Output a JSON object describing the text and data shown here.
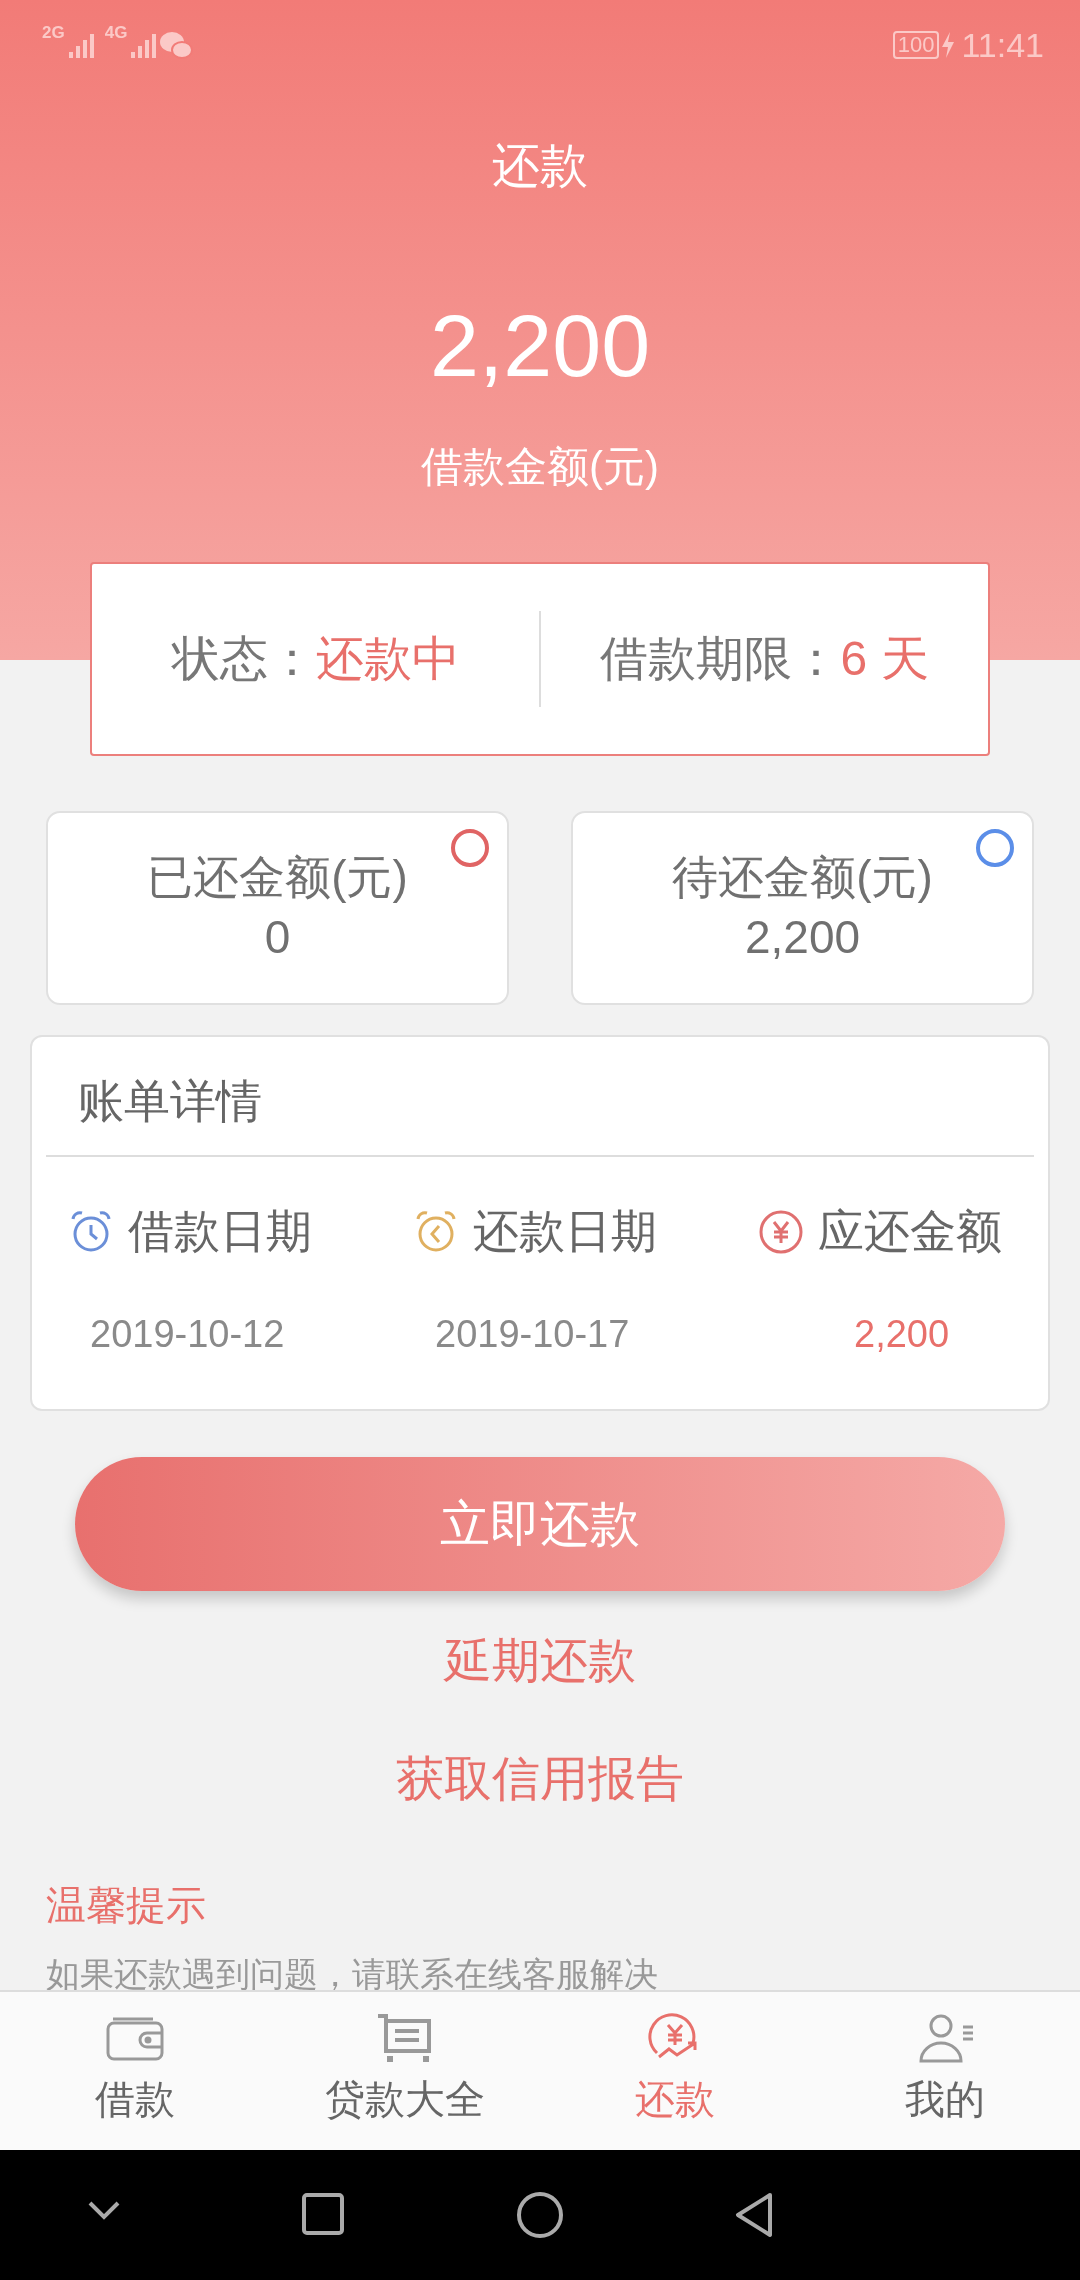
{
  "status_bar": {
    "network_1": "2G",
    "network_2": "4G",
    "battery": "100",
    "time": "11:41"
  },
  "header": {
    "title": "还款",
    "amount": "2,200",
    "amount_label": "借款金额(元)"
  },
  "loan_status": {
    "status_label": "状态：",
    "status_value": "还款中",
    "term_label": "借款期限：",
    "term_value": "6 天"
  },
  "summary_cards": [
    {
      "label": "已还金额(元)",
      "value": "0",
      "color": "#e06464"
    },
    {
      "label": "待还金额(元)",
      "value": "2,200",
      "color": "#5b8ee8"
    }
  ],
  "bill": {
    "title": "账单详情",
    "columns": [
      {
        "kind": "clock",
        "label": "借款日期",
        "value": "2019-10-12",
        "color": "#6b8fd8",
        "highlighted": false
      },
      {
        "kind": "clock_back",
        "label": "还款日期",
        "value": "2019-10-17",
        "color": "#e0b060",
        "highlighted": false
      },
      {
        "kind": "yuan",
        "label": "应还金额",
        "value": "2,200",
        "color": "#e07070",
        "highlighted": true
      }
    ]
  },
  "actions": {
    "primary": "立即还款",
    "links": [
      "延期还款",
      "获取信用报告"
    ]
  },
  "tip": {
    "title": "温馨提示",
    "text": "如果还款遇到问题，请联系在线客服解决"
  },
  "tabs": [
    {
      "kind": "wallet",
      "label": "借款",
      "selected": false
    },
    {
      "kind": "cart",
      "label": "贷款大全",
      "selected": false
    },
    {
      "kind": "repay",
      "label": "还款",
      "selected": true
    },
    {
      "kind": "person",
      "label": "我的",
      "selected": false
    }
  ]
}
